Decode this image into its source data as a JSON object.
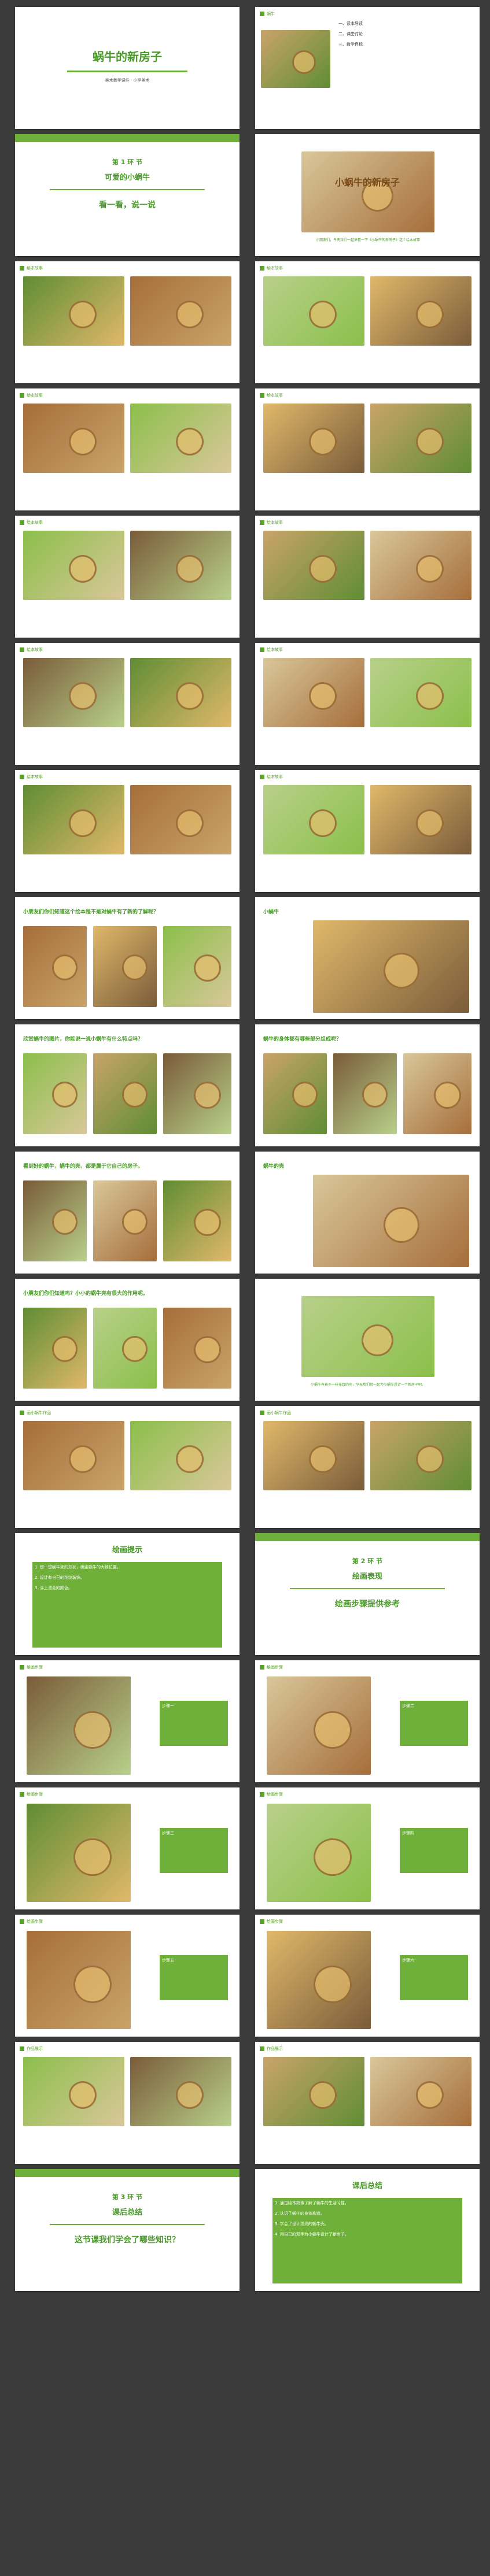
{
  "slides": [
    {
      "title": "蜗牛的新房子",
      "subtitle": "美术教学课件 · 小学美术"
    },
    {
      "header": "蜗牛",
      "items": [
        "一、读本导读",
        "二、课堂讨论",
        "三、教学目标"
      ]
    },
    {
      "section": "第 1 环 节",
      "title": "可爱的小蜗牛",
      "prompt": "看一看，说一说"
    },
    {
      "caption": "小朋友们，今天我们一起来看一下《小蜗牛的新房子》这个绘本故事",
      "book_title": "小蜗牛的新房子"
    },
    {
      "header": "绘本故事"
    },
    {
      "header": "绘本故事"
    },
    {
      "header": "绘本故事"
    },
    {
      "header": "绘本故事"
    },
    {
      "header": "绘本故事"
    },
    {
      "header": "绘本故事"
    },
    {
      "header": "绘本故事"
    },
    {
      "header": "绘本故事"
    },
    {
      "header": "绘本故事"
    },
    {
      "header": "绘本故事"
    },
    {
      "question": "小朋友们你们知道这个绘本是不是对蜗牛有了新的了解呢？"
    },
    {
      "label": "小蜗牛"
    },
    {
      "question": "欣赏蜗牛的图片，你能说一说小蜗牛有什么特点吗？"
    },
    {
      "question": "蜗牛的身体都有哪些部分组成呢？"
    },
    {
      "question": "看到好的蜗牛，蜗牛的壳，都是属于它自己的房子。"
    },
    {
      "label": "蜗牛的壳"
    },
    {
      "question": "小朋友们你们知道吗？小小的蜗牛壳有很大的作用呢。"
    },
    {
      "caption": "小蜗牛有着不一样花纹的壳，今天我们就一起为小蜗牛设计一个新房子吧。"
    },
    {
      "header": "画小蜗牛作品"
    },
    {
      "header": "画小蜗牛作品"
    },
    {
      "title": "绘画提示",
      "tips": [
        "1. 想一想蜗牛壳的形状，确定蜗牛的大致位置。",
        "2. 设计有自己的花纹装饰。",
        "3. 涂上漂亮的颜色。"
      ]
    },
    {
      "section": "第 2 环 节",
      "title": "绘画表现",
      "prompt": "绘画步骤提供参考"
    },
    {
      "header": "绘画步骤",
      "step": "步骤一"
    },
    {
      "header": "绘画步骤",
      "step": "步骤二"
    },
    {
      "header": "绘画步骤",
      "step": "步骤三"
    },
    {
      "header": "绘画步骤",
      "step": "步骤四"
    },
    {
      "header": "绘画步骤",
      "step": "步骤五"
    },
    {
      "header": "绘画步骤",
      "step": "步骤六"
    },
    {
      "header": "作品展示"
    },
    {
      "header": "作品展示"
    },
    {
      "section": "第 3 环 节",
      "title": "课后总结",
      "prompt": "这节课我们学会了哪些知识？"
    },
    {
      "title": "课后总结",
      "items": [
        "1. 通过绘本故事了解了蜗牛的生活习性。",
        "2. 认识了蜗牛的身体构造。",
        "3. 学会了设计漂亮的蜗牛壳。",
        "4. 用自己的双手为小蜗牛设计了新房子。"
      ]
    }
  ],
  "colors": {
    "accent": "#5aa02c",
    "background": "#3b3b3b"
  }
}
